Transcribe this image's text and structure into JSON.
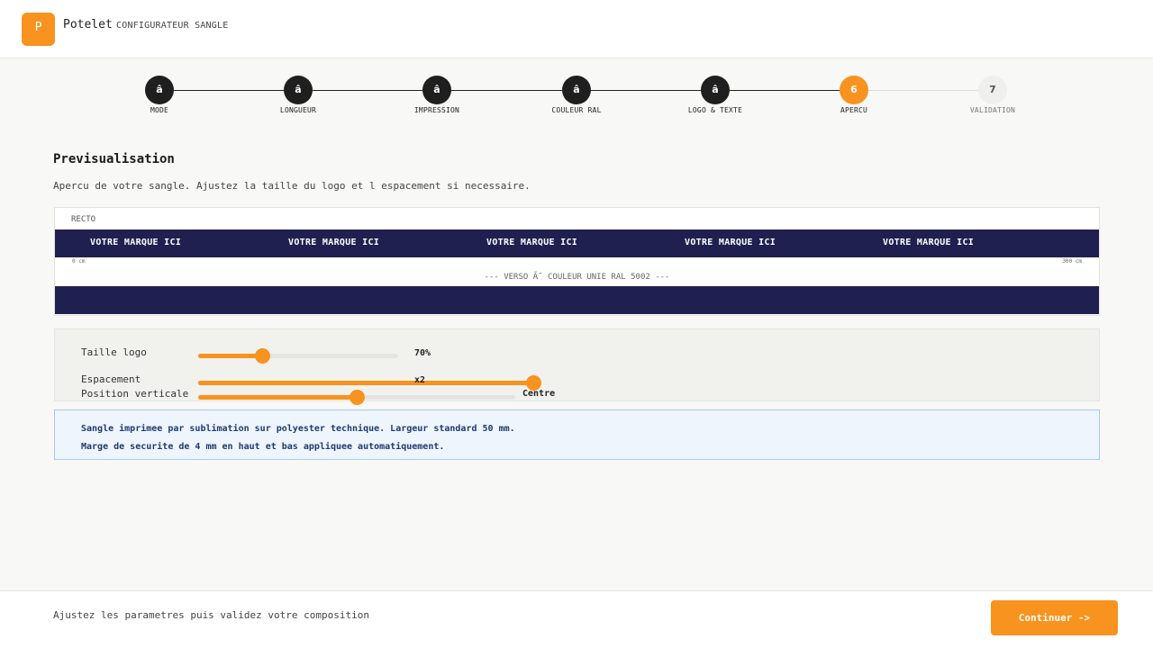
{
  "header": {
    "logo_letter": "P",
    "brand": "Potelet",
    "subtitle": "CONFIGURATEUR SANGLE"
  },
  "stepper": {
    "steps": [
      {
        "marker": "â",
        "label": "MODE",
        "state": "done"
      },
      {
        "marker": "â",
        "label": "LONGUEUR",
        "state": "done"
      },
      {
        "marker": "â",
        "label": "IMPRESSION",
        "state": "done"
      },
      {
        "marker": "â",
        "label": "COULEUR RAL",
        "state": "done"
      },
      {
        "marker": "â",
        "label": "LOGO & TEXTE",
        "state": "done"
      },
      {
        "marker": "6",
        "label": "APERCU",
        "state": "active"
      },
      {
        "marker": "7",
        "label": "VALIDATION",
        "state": "pending"
      }
    ]
  },
  "main": {
    "title": "Previsualisation",
    "subtitle": "Apercu de votre sangle. Ajustez la taille du logo et l espacement si necessaire."
  },
  "preview": {
    "recto_label": "RECTO",
    "brand_texts": [
      "VOTRE MARQUE ICI",
      "VOTRE MARQUE ICI",
      "VOTRE MARQUE ICI",
      "VOTRE MARQUE ICI",
      "VOTRE MARQUE ICI"
    ],
    "ruler_start": "0 cm",
    "ruler_end": "300 cm",
    "verso_label": "--- VERSO Ã˜ COULEUR UNIE RAL 5002 ---",
    "strap_color": "#202050"
  },
  "controls": {
    "logo_size": {
      "label": "Taille logo",
      "value_text": "70%",
      "fraction": 0.32
    },
    "spacing": {
      "label": "Espacement",
      "value_text": "x2",
      "fraction": 1.0
    },
    "vertical": {
      "label": "Position verticale",
      "value_text": "Centre",
      "fraction": 0.5
    }
  },
  "info": {
    "line1": "Sangle imprimee par sublimation sur polyester technique. Largeur standard 50 mm.",
    "line2": "Marge de securite de 4 mm en haut et bas appliquee automatiquement."
  },
  "footer": {
    "hint": "Ajustez les parametres puis validez votre composition",
    "continue_label": "Continuer ->"
  },
  "colors": {
    "accent": "#f7931e",
    "strap": "#202050",
    "info_bg": "#eef5fd",
    "info_text": "#1e3a6e"
  }
}
